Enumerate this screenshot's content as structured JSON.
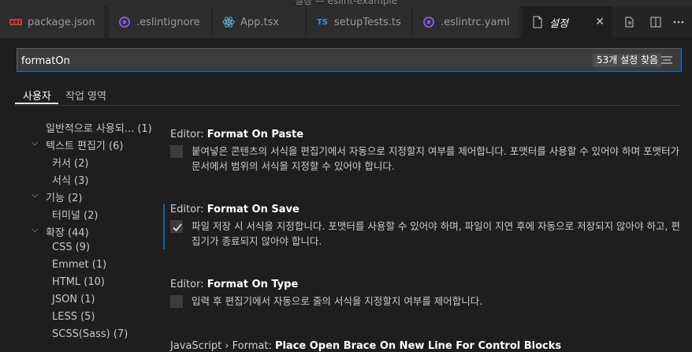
{
  "window": {
    "title": "설정 — eslint-example"
  },
  "tabs": [
    {
      "label": "package.json",
      "icon": "npm-icon",
      "color": "#cb3837"
    },
    {
      "label": ".eslintignore",
      "icon": "eslint-icon",
      "color": "#7f5fd8"
    },
    {
      "label": "App.tsx",
      "icon": "react-icon",
      "color": "#5fb3e0"
    },
    {
      "label": "setupTests.ts",
      "icon": "ts-icon",
      "color": "#3f8fd6"
    },
    {
      "label": ".eslintrc.yaml",
      "icon": "eslint-icon",
      "color": "#7f5fd8"
    },
    {
      "label": "설정",
      "icon": "file-icon",
      "active": true
    }
  ],
  "search": {
    "value": "formatOn",
    "result_count": "53개 설정 찾음"
  },
  "scopes": [
    {
      "label": "사용자"
    },
    {
      "label": "작업 영역"
    }
  ],
  "toc": [
    {
      "label": "일반적으로 사용되... (1)"
    },
    {
      "label": "텍스트 편집기 (6)"
    },
    {
      "label": "커서 (2)"
    },
    {
      "label": "서식 (3)"
    },
    {
      "label": "기능 (2)"
    },
    {
      "label": "터미널 (2)"
    },
    {
      "label": "확장 (44)"
    },
    {
      "label": "CSS (9)"
    },
    {
      "label": "Emmet (1)"
    },
    {
      "label": "HTML (10)"
    },
    {
      "label": "JSON (1)"
    },
    {
      "label": "LESS (5)"
    },
    {
      "label": "SCSS(Sass) (7)"
    }
  ],
  "settings": [
    {
      "category": "Editor: ",
      "name": "Format On Paste",
      "checked": false,
      "description": "붙여넣은 콘텐츠의 서식을 편집기에서 자동으로 지정할지 여부를 제어합니다. 포맷터를 사용할 수 있어야 하며 포맷터가 문서에서 범위의 서식을 지정할 수 있어야 합니다."
    },
    {
      "category": "Editor: ",
      "name": "Format On Save",
      "checked": true,
      "description": "파일 저장 시 서식을 지정합니다. 포맷터를 사용할 수 있어야 하며, 파일이 지연 후에 자동으로 저장되지 않아야 하고, 편집기가 종료되지 않아야 합니다."
    },
    {
      "category": "Editor: ",
      "name": "Format On Type",
      "checked": false,
      "description": "입력 후 편집기에서 자동으로 줄의 서식을 지정할지 여부를 제어합니다."
    },
    {
      "category": "JavaScript › Format: ",
      "name": "Place Open Brace On New Line For Control Blocks"
    }
  ]
}
